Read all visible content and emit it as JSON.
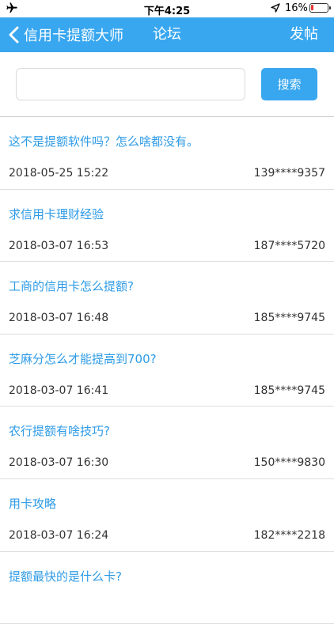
{
  "status_bar": {
    "time": "下午4:25",
    "battery_percent": "16%",
    "battery_level": 0.16,
    "battery_color": "#e53935",
    "icons": [
      "airplane-icon",
      "location-icon",
      "battery-icon"
    ]
  },
  "nav": {
    "back_label": "信用卡提额大师",
    "title": "论坛",
    "post_label": "发帖",
    "color": "#38a7f0"
  },
  "search": {
    "placeholder": "",
    "value": "",
    "button_label": "搜索"
  },
  "posts": [
    {
      "title": "这不是提额软件吗？怎么啥都没有。",
      "date": "2018-05-25 15:22",
      "user": "139****9357"
    },
    {
      "title": "求信用卡理财经验",
      "date": "2018-03-07 16:53",
      "user": "187****5720"
    },
    {
      "title": "工商的信用卡怎么提额?",
      "date": "2018-03-07 16:48",
      "user": "185****9745"
    },
    {
      "title": "芝麻分怎么才能提高到700?",
      "date": "2018-03-07 16:41",
      "user": "185****9745"
    },
    {
      "title": "农行提额有啥技巧?",
      "date": "2018-03-07 16:30",
      "user": "150****9830"
    },
    {
      "title": "用卡攻略",
      "date": "2018-03-07 16:24",
      "user": "182****2218"
    },
    {
      "title": "提额最快的是什么卡?",
      "date": "",
      "user": ""
    }
  ]
}
